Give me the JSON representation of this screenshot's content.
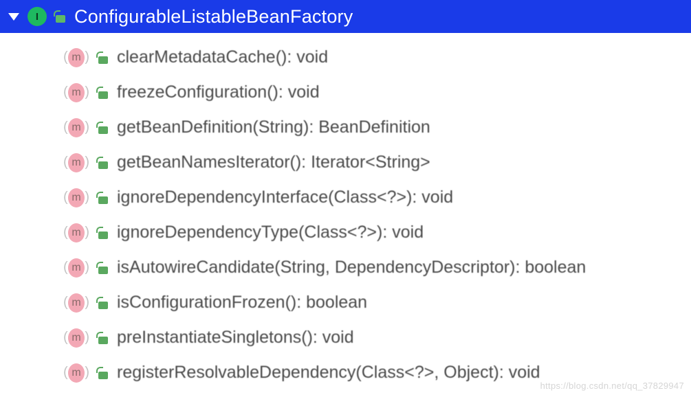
{
  "header": {
    "title": "ConfigurableListableBeanFactory",
    "badge_letter": "I"
  },
  "method_badge_letter": "m",
  "methods": [
    {
      "signature": "clearMetadataCache(): void"
    },
    {
      "signature": "freezeConfiguration(): void"
    },
    {
      "signature": "getBeanDefinition(String): BeanDefinition"
    },
    {
      "signature": "getBeanNamesIterator(): Iterator<String>"
    },
    {
      "signature": "ignoreDependencyInterface(Class<?>): void"
    },
    {
      "signature": "ignoreDependencyType(Class<?>): void"
    },
    {
      "signature": "isAutowireCandidate(String, DependencyDescriptor): boolean"
    },
    {
      "signature": "isConfigurationFrozen(): boolean"
    },
    {
      "signature": "preInstantiateSingletons(): void"
    },
    {
      "signature": "registerResolvableDependency(Class<?>, Object): void"
    }
  ],
  "watermark": "https://blog.csdn.net/qq_37829947"
}
